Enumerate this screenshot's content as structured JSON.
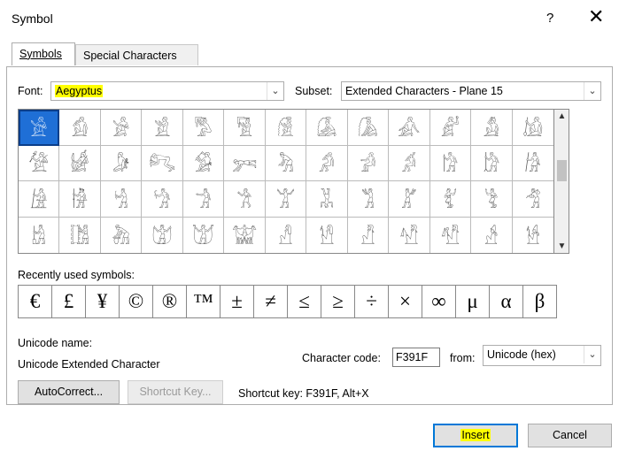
{
  "window": {
    "title": "Symbol",
    "help_glyph": "?",
    "close_glyph": "✕"
  },
  "tabs": [
    {
      "label": "Symbols",
      "active": true
    },
    {
      "label": "Special Characters",
      "active": false
    }
  ],
  "font": {
    "label": "Font:",
    "value": "Aegyptus"
  },
  "subset": {
    "label": "Subset:",
    "value": "Extended Characters - Plane 15"
  },
  "symbol_grid": {
    "rows": 4,
    "cols": 13,
    "selected_index": 0,
    "cells": [
      "𓀀",
      "𓀁",
      "𓀂",
      "𓀃",
      "𓀄",
      "𓀅",
      "𓀆",
      "𓀇",
      "𓀈",
      "𓀉",
      "𓀊",
      "𓀋",
      "𓀌",
      "𓀍",
      "𓀎",
      "𓀏",
      "𓀐",
      "𓀑",
      "𓀒",
      "𓀓",
      "𓀔",
      "𓀕",
      "𓀖",
      "𓀗",
      "𓀘",
      "𓀙",
      "𓀚",
      "𓀛",
      "𓀜",
      "𓀝",
      "𓀞",
      "𓀟",
      "𓀠",
      "𓀡",
      "𓀢",
      "𓀣",
      "𓀤",
      "𓀥",
      "𓀦",
      "𓀧",
      "𓀨",
      "𓀩",
      "𓀪",
      "𓀫",
      "𓀬",
      "𓀭",
      "𓀮",
      "𓀯",
      "𓀰",
      "𓀱",
      "𓀲",
      "𓀳"
    ]
  },
  "recent": {
    "label": "Recently used symbols:",
    "symbols": [
      "€",
      "£",
      "¥",
      "©",
      "®",
      "™",
      "±",
      "≠",
      "≤",
      "≥",
      "÷",
      "×",
      "∞",
      "μ",
      "α",
      "β"
    ]
  },
  "unicode": {
    "name_label": "Unicode name:",
    "name_value": "Unicode Extended Character"
  },
  "char_code": {
    "label": "Character code:",
    "value": "F391F",
    "from_label": "from:",
    "from_value": "Unicode (hex)"
  },
  "buttons": {
    "autocorrect": "AutoCorrect...",
    "shortcut_key": "Shortcut Key...",
    "shortcut_text": "Shortcut key: F391F, Alt+X",
    "insert": "Insert",
    "cancel": "Cancel"
  },
  "colors": {
    "highlight": "#ffff00",
    "selection": "#1f6fd6",
    "focus": "#0078d7"
  }
}
